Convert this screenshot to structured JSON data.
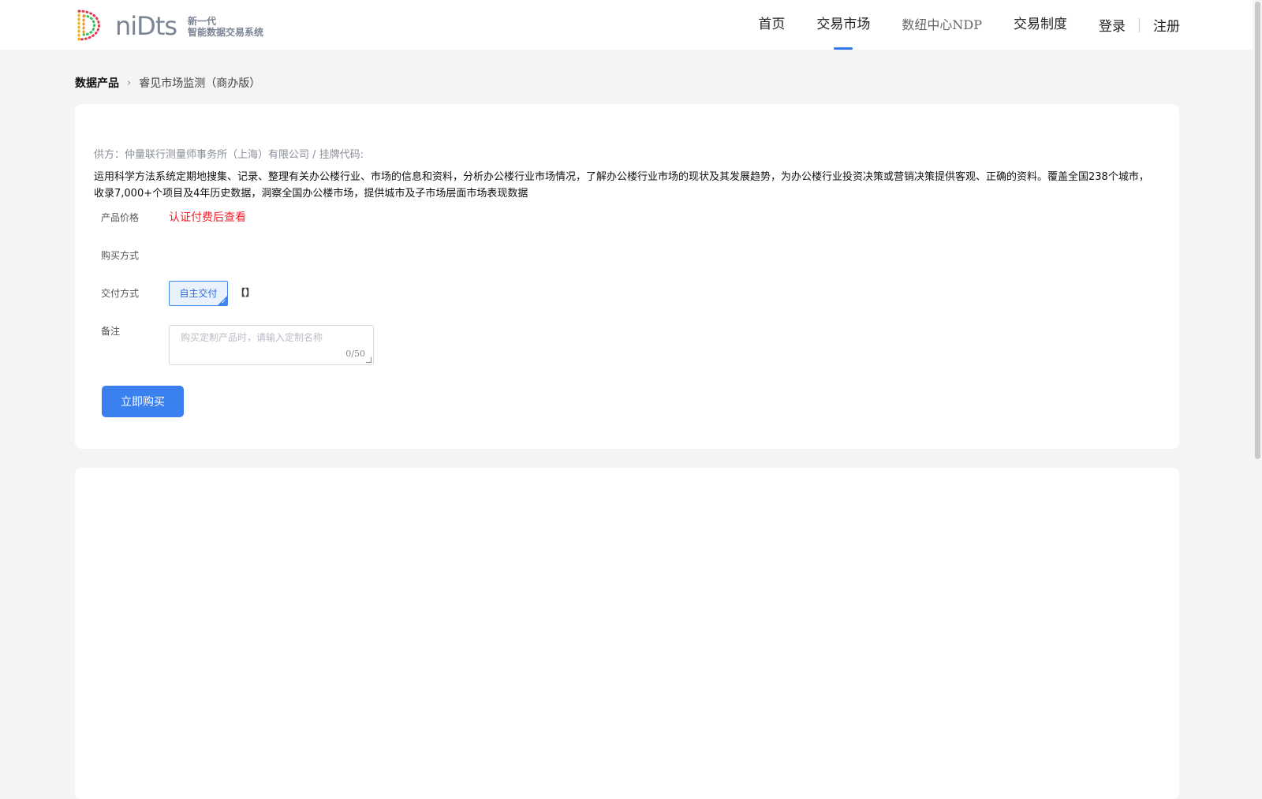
{
  "header": {
    "logo_word": "niDts",
    "logo_tag_line1": "新一代",
    "logo_tag_line2": "智能数据交易系统",
    "nav": [
      {
        "label": "首页"
      },
      {
        "label": "交易市场"
      },
      {
        "label": "数纽中心NDP"
      },
      {
        "label": "交易制度"
      }
    ],
    "login_label": "登录",
    "register_label": "注册",
    "accent_color": "#2f7bef"
  },
  "breadcrumb": {
    "root": "数据产品",
    "current": "睿见市场监测（商办版）"
  },
  "product": {
    "supplier_line": "供方：仲量联行测量师事务所（上海）有限公司 / 挂牌代码:",
    "description": "运用科学方法系统定期地搜集、记录、整理有关办公楼行业、市场的信息和资料，分析办公楼行业市场情况，了解办公楼行业市场的现状及其发展趋势，为办公楼行业投资决策或营销决策提供客观、正确的资料。覆盖全国238个城市，收录7,000+个项目及4年历史数据，洞察全国办公楼市场，提供城市及子市场层面市场表现数据",
    "price_label": "产品价格",
    "price_value": "认证付费后查看",
    "purchase_label": "购买方式",
    "delivery_label": "交付方式",
    "delivery_option": "自主交付",
    "delivery_extra": "【】",
    "remark_label": "备注",
    "remark_placeholder": "购买定制产品时，请输入定制名称",
    "remark_count": "0/50",
    "buy_button": "立即购买"
  }
}
